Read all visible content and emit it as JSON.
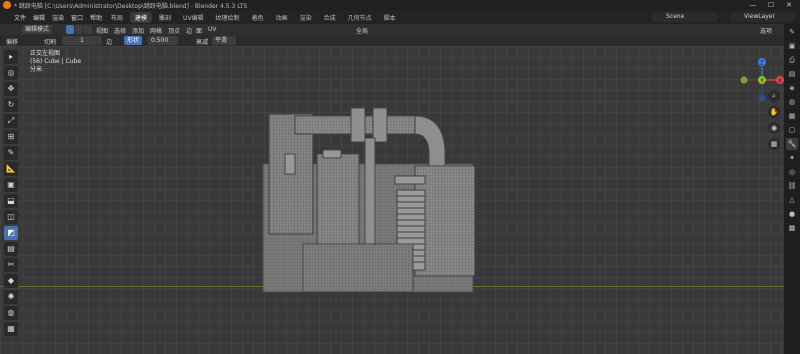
{
  "titlebar": {
    "title": "* 跳跃电脑 [C:\\Users\\Administrator\\Desktop\\跳跃电脑.blend] - Blender 4.5.3 LTS",
    "minimize": "—",
    "maximize": "☐",
    "close": "✕"
  },
  "menubar": {
    "menus": [
      "文件",
      "编辑",
      "渲染",
      "窗口",
      "帮助"
    ],
    "workspace_tabs": [
      "布局",
      "建模",
      "雕刻",
      "UV编辑",
      "纹理绘制",
      "着色",
      "动画",
      "渲染",
      "合成",
      "几何节点",
      "脚本"
    ],
    "active_tab": "建模",
    "scene": "Scene",
    "view_layer": "ViewLayer"
  },
  "header1": {
    "mode": "编辑模式",
    "menus": [
      "视图",
      "选择",
      "添加",
      "网格",
      "顶点",
      "边",
      "面",
      "UV"
    ],
    "transform_orientation": "全局",
    "options": "选项"
  },
  "header2": {
    "operator": "偏移",
    "cuts_label": "切割",
    "cuts_value": "1",
    "edge_label": "边",
    "smooth_label": "形状",
    "smooth_value": "0.500",
    "falloff_label": "衰减",
    "falloff_value": "平滑"
  },
  "viewport": {
    "view_name": "正交左视图",
    "object_info": "(56) Cube | Cube",
    "units": "分米"
  },
  "gizmo": {
    "x_label": "X",
    "y_label": "Y",
    "z_label": "Z"
  },
  "colors": {
    "accent": "#4772b3",
    "brand": "#e87d0d",
    "x_axis": "#e2414f",
    "y_axis": "#8bc132",
    "z_axis": "#3e7ce5"
  }
}
